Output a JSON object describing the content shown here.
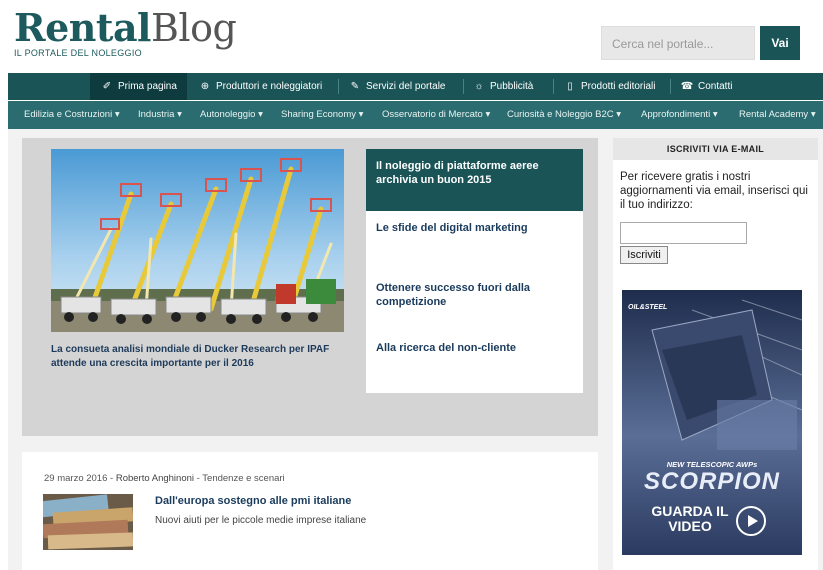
{
  "header": {
    "logo_bold": "Rental",
    "logo_light": "Blog",
    "logo_sub": "IL PORTALE DEL NOLEGGIO",
    "search_placeholder": "Cerca nel portale...",
    "search_button": "Vai"
  },
  "mainnav": {
    "items": [
      {
        "label": "Prima pagina",
        "icon": "rocket-icon",
        "glyph": "✐"
      },
      {
        "label": "Produttori e noleggiatori",
        "icon": "globe-icon",
        "glyph": "⊕"
      },
      {
        "label": "Servizi del portale",
        "icon": "wrench-icon",
        "glyph": "✎"
      },
      {
        "label": "Pubblicità",
        "icon": "broadcast-icon",
        "glyph": "☼"
      },
      {
        "label": "Prodotti editoriali",
        "icon": "book-icon",
        "glyph": "▯"
      },
      {
        "label": "Contatti",
        "icon": "phone-icon",
        "glyph": "☎"
      }
    ]
  },
  "subnav": {
    "items": [
      "Edilizia e Costruzioni ▾",
      "Industria ▾",
      "Autonoleggio ▾",
      "Sharing Economy ▾",
      "Osservatorio di Mercato ▾",
      "Curiosità e Noleggio B2C ▾",
      "Approfondimenti ▾",
      "Rental Academy ▾"
    ]
  },
  "featured": {
    "caption": "La consueta analisi mondiale di Ducker Research per IPAF attende una crescita importante per il 2016",
    "list": [
      "Il noleggio di piattaforme aeree archivia un buon 2015",
      "Le sfide del digital marketing",
      "Ottenere successo fuori dalla competizione",
      "Alla ricerca del non-cliente"
    ]
  },
  "post": {
    "date": "29 marzo 2016",
    "author": "Roberto Anghinoni",
    "category": "Tendenze e scenari",
    "title": "Dall'europa sostegno alle pmi italiane",
    "subtitle": "Nuovi aiuti per le piccole medie imprese italiane"
  },
  "sidebar": {
    "heading": "ISCRIVITI VIA E-MAIL",
    "text": "Per ricevere gratis i nostri aggiornamenti via email, inserisci qui il tuo indirizzo:",
    "button": "Iscriviti"
  },
  "ad": {
    "brand": "OIL&STEEL",
    "small": "NEW TELESCOPIC AWPs",
    "big": "SCORPION",
    "cta": "GUARDA IL VIDEO"
  },
  "colors": {
    "brand_teal": "#1a5457",
    "subnav_teal": "#2a6c6f",
    "headline_blue": "#1a3b5c"
  }
}
